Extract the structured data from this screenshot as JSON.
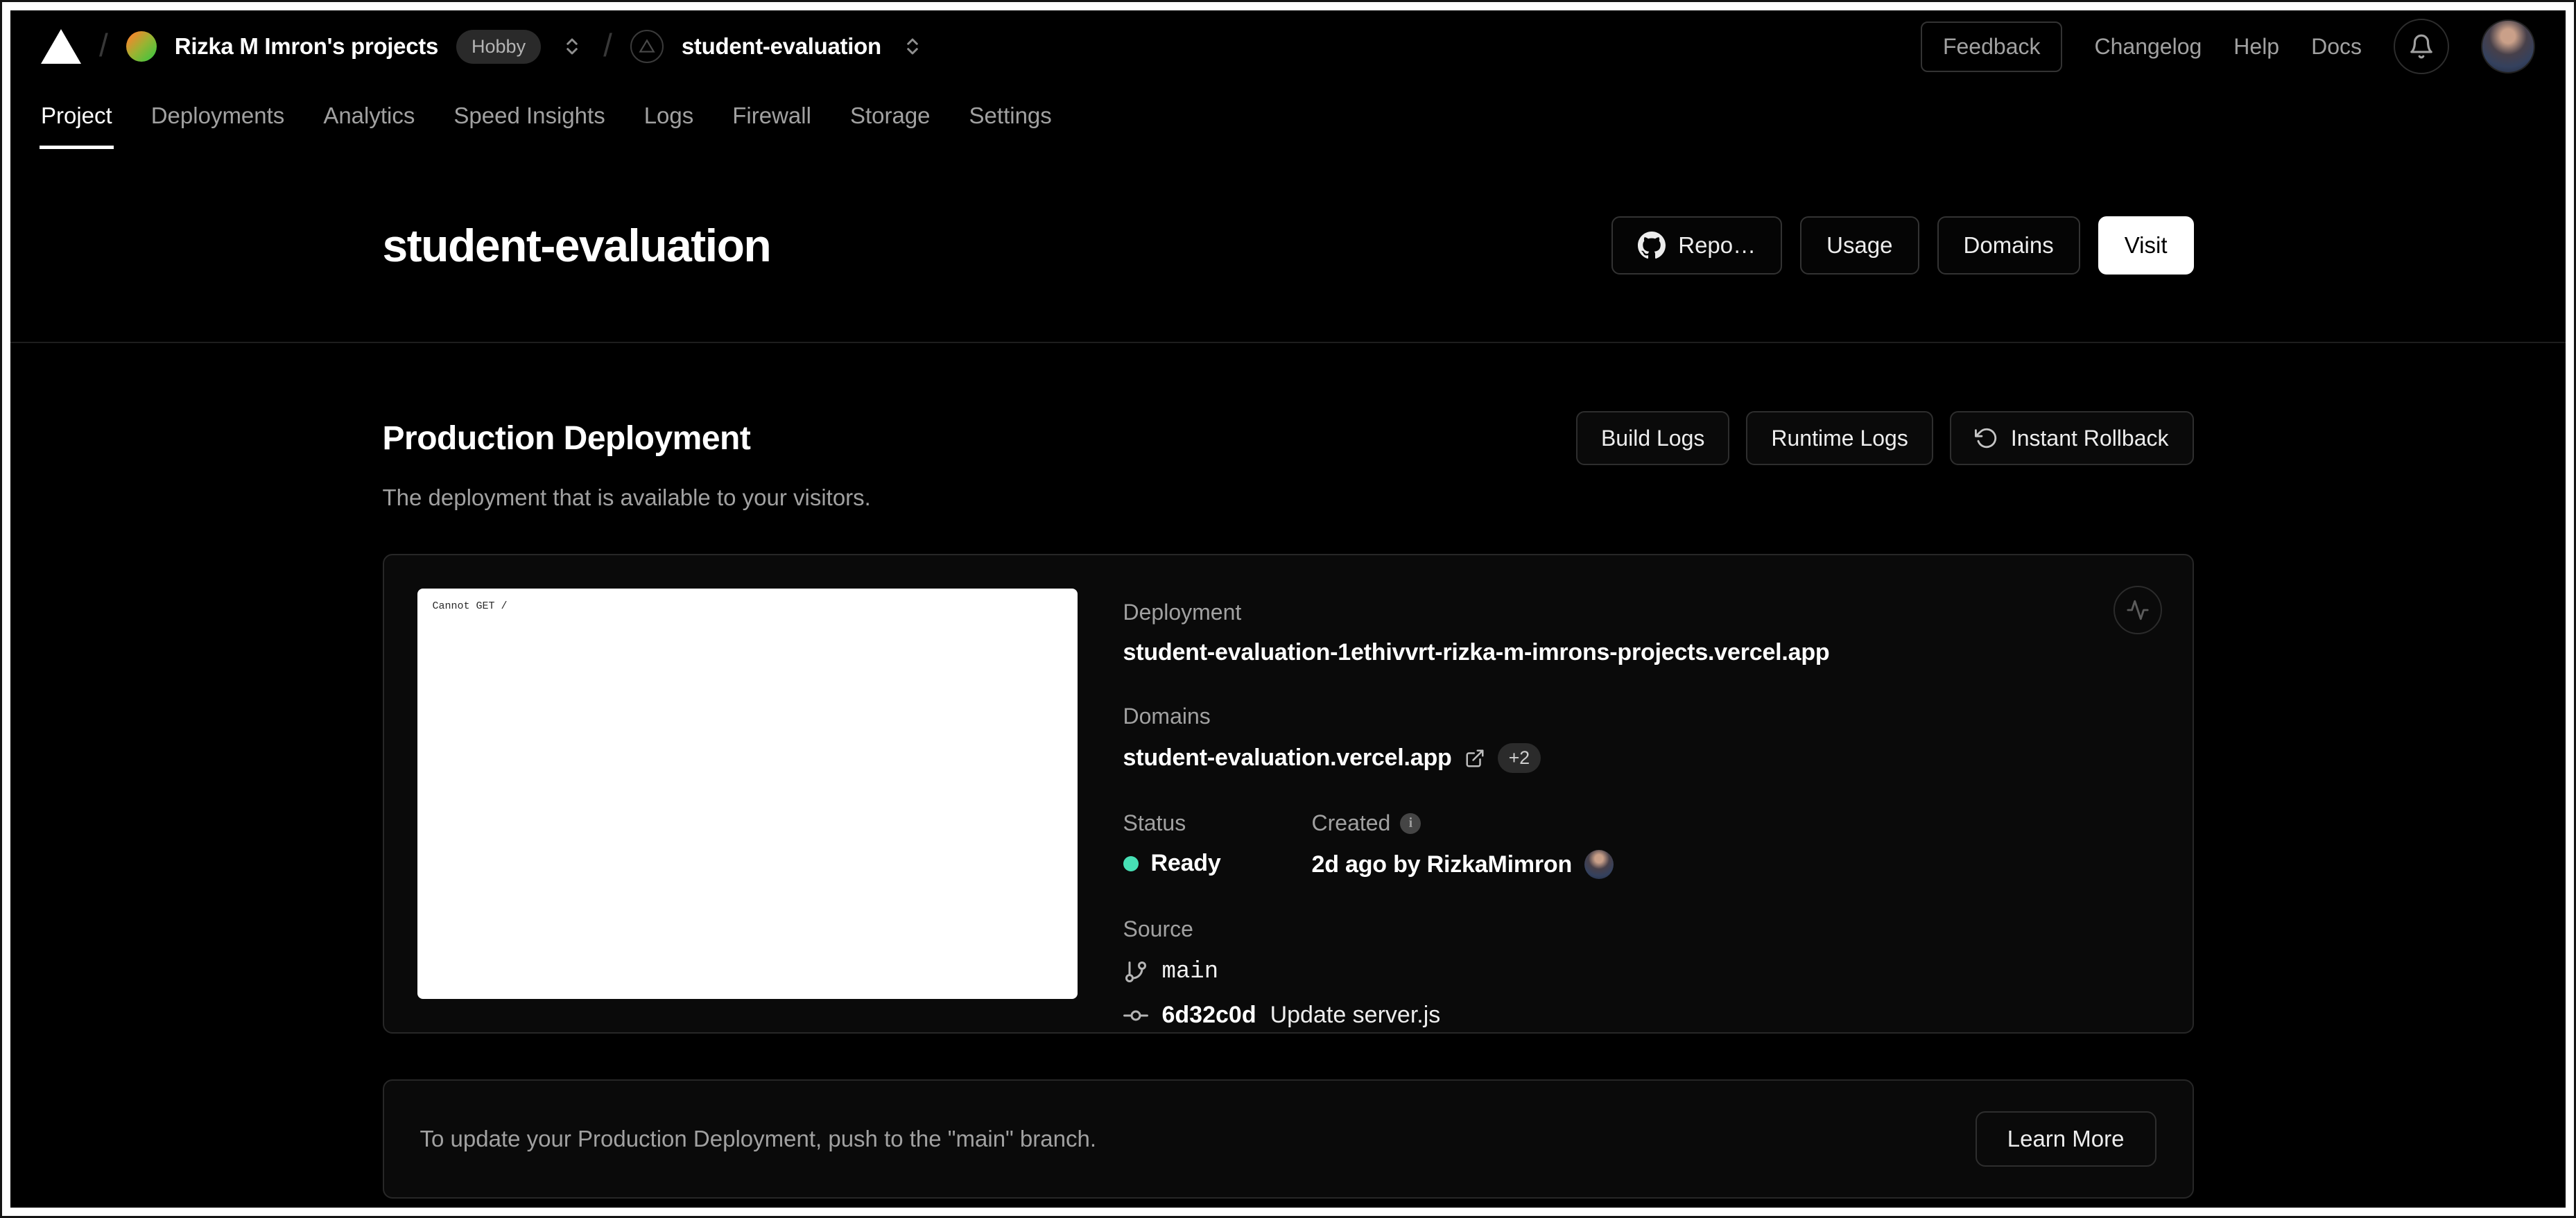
{
  "colors": {
    "ready_green": "#47e0b5",
    "page_bg": "#000000",
    "card_border": "#272727",
    "muted_text": "#a1a1a1"
  },
  "topnav": {
    "breadcrumb": {
      "team_name": "Rizka M Imron's projects",
      "plan_badge": "Hobby",
      "project_name": "student-evaluation"
    },
    "feedback_button": "Feedback",
    "links": [
      {
        "label": "Changelog"
      },
      {
        "label": "Help"
      },
      {
        "label": "Docs"
      }
    ]
  },
  "tabs": [
    {
      "label": "Project",
      "active": true
    },
    {
      "label": "Deployments",
      "active": false
    },
    {
      "label": "Analytics",
      "active": false
    },
    {
      "label": "Speed Insights",
      "active": false
    },
    {
      "label": "Logs",
      "active": false
    },
    {
      "label": "Firewall",
      "active": false
    },
    {
      "label": "Storage",
      "active": false
    },
    {
      "label": "Settings",
      "active": false
    }
  ],
  "page_header": {
    "title": "student-evaluation",
    "repo_button": "Repo…",
    "usage_button": "Usage",
    "domains_button": "Domains",
    "visit_button": "Visit"
  },
  "production": {
    "heading": "Production Deployment",
    "subtitle": "The deployment that is available to your visitors.",
    "build_logs_button": "Build Logs",
    "runtime_logs_button": "Runtime Logs",
    "instant_rollback_button": "Instant Rollback"
  },
  "deployment": {
    "preview_text": "Cannot GET /",
    "deployment_label": "Deployment",
    "deployment_url": "student-evaluation-1ethivvrt-rizka-m-imrons-projects.vercel.app",
    "domains_label": "Domains",
    "primary_domain": "student-evaluation.vercel.app",
    "extra_domains_badge": "+2",
    "status_label": "Status",
    "status_value": "Ready",
    "created_label": "Created",
    "created_value": "2d ago by RizkaMimron",
    "source_label": "Source",
    "branch_name": "main",
    "commit_hash": "6d32c0d",
    "commit_message": "Update server.js"
  },
  "footer_note": {
    "text": "To update your Production Deployment, push to the \"main\" branch.",
    "learn_more_button": "Learn More"
  }
}
